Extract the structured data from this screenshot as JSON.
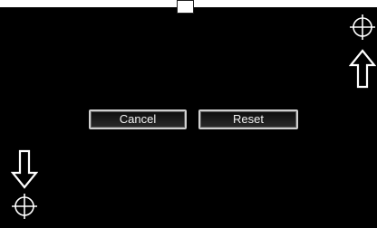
{
  "buttons": {
    "cancel_label": "Cancel",
    "reset_label": "Reset"
  },
  "icons": {
    "target_top_right": "crosshair-target-icon",
    "target_bottom_left": "crosshair-target-icon",
    "arrow_up": "arrow-up-icon",
    "arrow_down": "arrow-down-icon"
  },
  "colors": {
    "background": "#000000",
    "foreground": "#ffffff"
  }
}
